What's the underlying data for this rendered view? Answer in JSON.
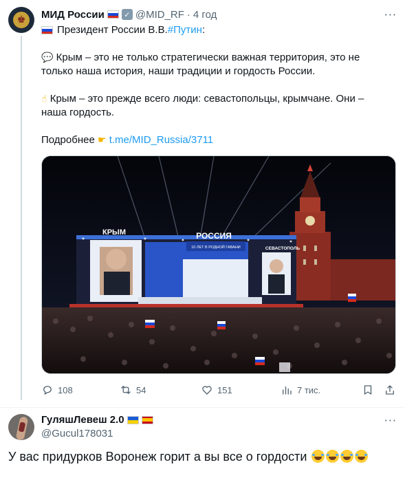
{
  "tweet": {
    "author_name": "МИД России",
    "author_handle": "@MID_RF",
    "separator": "·",
    "time": "4 год",
    "lines": {
      "intro": "Президент России В.В.",
      "hashtag": "#Путин",
      "intro_end": ":",
      "p1_line1": "Крым – это не только стратегически важная территория, это не",
      "p1_line2": "только наша история, наши традиции и гордость России.",
      "p2_line1": "Крым – это прежде всего люди: севастопольцы, крымчане. Они –",
      "p2_line2": "наша гордость.",
      "more_label": "Подробнее",
      "link": "t.me/MID_Russia/3711"
    },
    "photo": {
      "left_screen_label": "КРЫМ",
      "center_screen_label": "РОССИЯ",
      "center_screen_sublabel": "10 ЛЕТ В РОДНОЙ ГАВАНИ",
      "right_screen_label": "СЕВАСТОПОЛЬ"
    },
    "actions": {
      "replies": "108",
      "reposts": "54",
      "likes": "151",
      "views": "7 тис."
    },
    "icons": [
      "emblem-icon",
      "russia-flag-icon",
      "verified-badge-icon",
      "speech-bubble-emoji-icon",
      "pointing-hand-emoji-icon",
      "pointing-right-emoji-icon",
      "reply-icon",
      "repost-icon",
      "like-icon",
      "views-icon",
      "bookmark-icon",
      "share-icon",
      "more-icon"
    ]
  },
  "reply": {
    "author_name": "ГуляшЛевеш 2.0",
    "author_handle": "@Gucul178031",
    "text": "У вас придурков Воронеж горит а вы все о гордости",
    "icons": [
      "ukraine-flag-icon",
      "spain-flag-icon",
      "laughing-emoji-icon",
      "more-icon"
    ]
  },
  "colors": {
    "link": "#1d9bf0",
    "secondary_text": "#536471",
    "primary_text": "#0f1419",
    "divider": "#eff3f4"
  }
}
